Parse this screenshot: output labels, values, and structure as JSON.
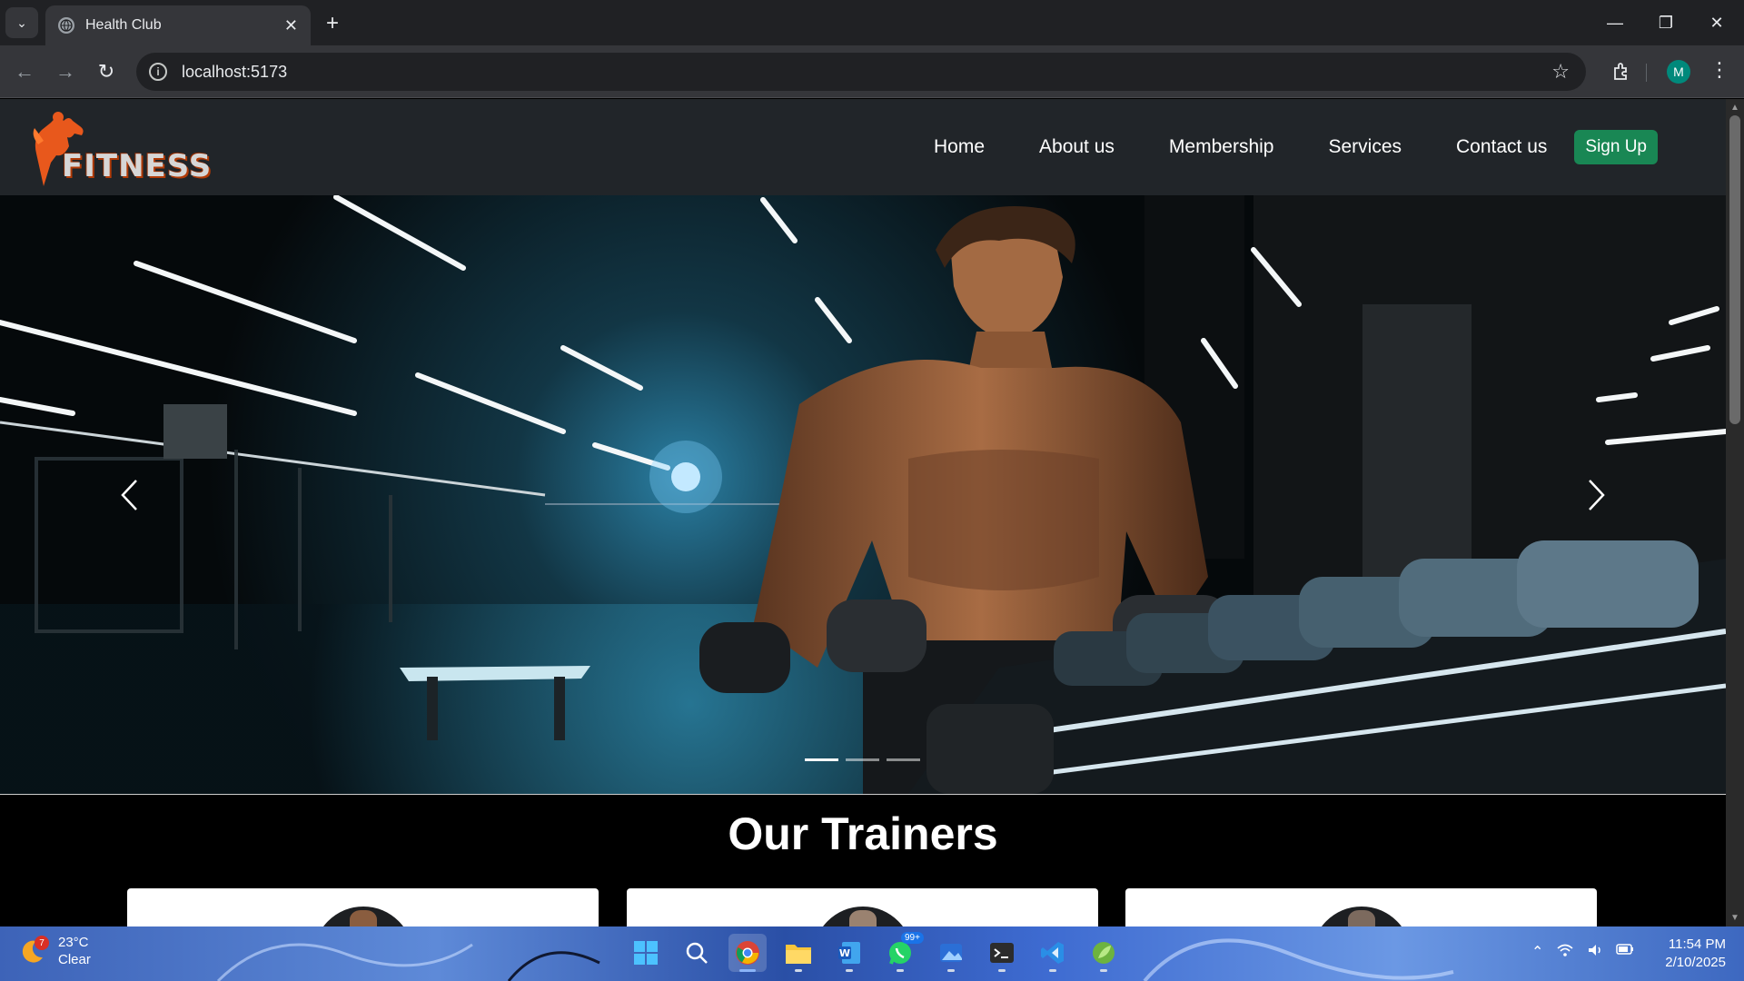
{
  "browser": {
    "tab_title": "Health Club",
    "url": "localhost:5173",
    "profile_initial": "M"
  },
  "site": {
    "logo_text": "FITNESS",
    "nav": [
      "Home",
      "About us",
      "Membership",
      "Services",
      "Contact us"
    ],
    "signup_label": "Sign Up",
    "signup_color": "#198754",
    "nav_bg": "#212529"
  },
  "carousel": {
    "slide_count": 3,
    "active_index": 0
  },
  "trainers": {
    "title": "Our Trainers",
    "card_count": 3
  },
  "taskbar": {
    "weather_temp": "23°C",
    "weather_desc": "Clear",
    "weather_badge": "7",
    "whatsapp_badge": "99+",
    "time": "11:54 PM",
    "date": "2/10/2025",
    "apps": [
      "windows-start",
      "search",
      "chrome",
      "file-explorer",
      "word",
      "whatsapp",
      "photos",
      "terminal",
      "vscode",
      "spring"
    ]
  }
}
